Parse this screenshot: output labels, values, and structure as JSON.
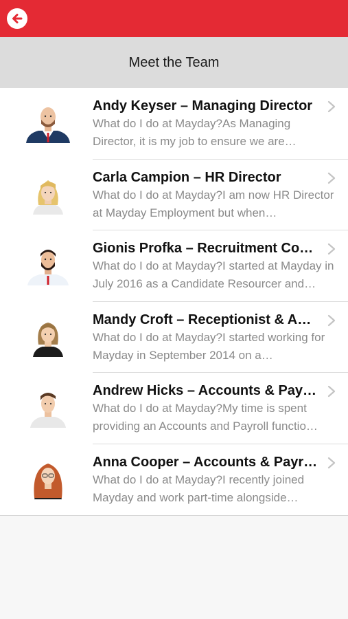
{
  "header": {
    "back_icon": "arrow-left-circle-icon",
    "color": "#e42a34",
    "title": "Meet the Team"
  },
  "team": [
    {
      "name": "Andy Keyser – Managing Director",
      "desc": "What do I do at Mayday?As Managing Director, it is my job to ensure we are…"
    },
    {
      "name": "Carla Campion – HR Director",
      "desc": "What do I do at Mayday?I am now HR Director at Mayday Employment but when…"
    },
    {
      "name": "Gionis Profka – Recruitment Con…",
      "desc": "What do I do at Mayday?I started at Mayday in July 2016 as a Candidate Resourcer and…"
    },
    {
      "name": "Mandy Croft – Receptionist & Ad…",
      "desc": "What do I do at Mayday?I started working for Mayday in September 2014 on a…"
    },
    {
      "name": "Andrew Hicks – Accounts & Payr…",
      "desc": "What do I do at Mayday?My time is spent providing an Accounts and Payroll functio…"
    },
    {
      "name": "Anna Cooper – Accounts & Payroll",
      "desc": "What do I do at Mayday?I recently joined Mayday and work part-time alongside…"
    }
  ]
}
